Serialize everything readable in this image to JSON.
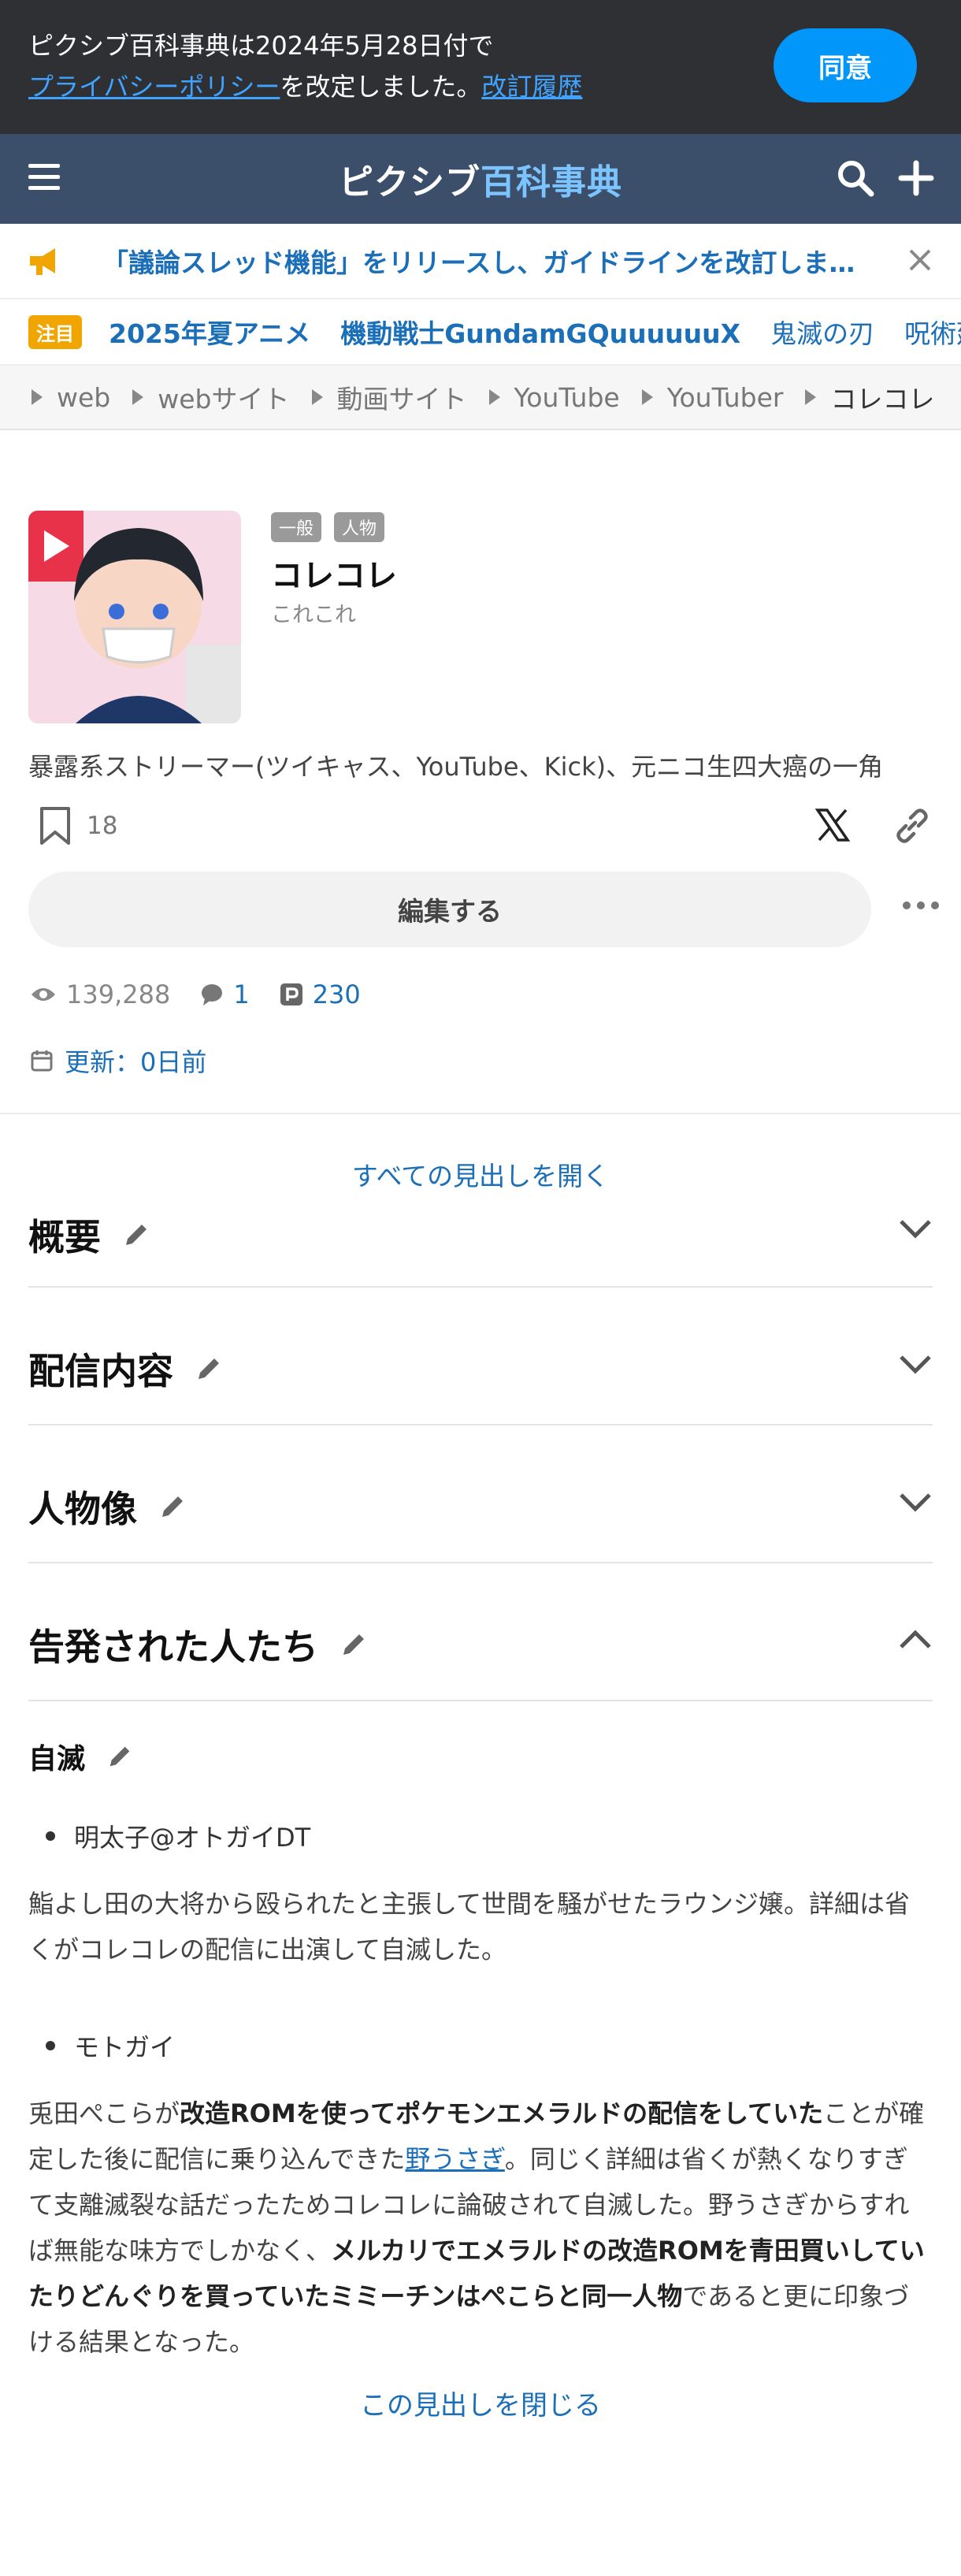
{
  "consent": {
    "line1": "ピクシブ百科事典は2024年5月28日付で",
    "privacy_link": "プライバシーポリシー",
    "line2_mid": "を改定しました。",
    "history_link": "改訂履歴",
    "agree": "同意"
  },
  "header": {
    "logo_a": "ピクシブ",
    "logo_b": "百科事典"
  },
  "announcement": {
    "text": "「議論スレッド機能」をリリースし、ガイドラインを改訂しま…"
  },
  "trending": {
    "badge": "注目",
    "tags": [
      "2025年夏アニメ",
      "機動戦士GundamGQuuuuuuX",
      "鬼滅の刃",
      "呪術廻戦"
    ]
  },
  "breadcrumbs": [
    "web",
    "webサイト",
    "動画サイト",
    "YouTube",
    "YouTuber",
    "コレコレ"
  ],
  "article": {
    "chips": [
      "一般",
      "人物"
    ],
    "title": "コレコレ",
    "reading": "これこれ",
    "description": "暴露系ストリーマー(ツイキャス、YouTube、Kick)、元ニコ生四大癌の一角",
    "bookmarks": "18",
    "edit": "編集する",
    "views": "139,288",
    "comments": "1",
    "pixiv_count": "230",
    "updated": "更新：0日前"
  },
  "toc": {
    "open_all": "すべての見出しを開く",
    "close": "この見出しを閉じる"
  },
  "sections": [
    "概要",
    "配信内容",
    "人物像",
    "告発された人たち"
  ],
  "subsection": {
    "title": "自滅",
    "item1": "明太子@オトガイDT",
    "para1": "鮨よし田の大将から殴られたと主張して世間を騒がせたラウンジ嬢。詳細は省くがコレコレの配信に出演して自滅した。",
    "item2": "モトガイ",
    "p2_a": "兎田ぺこらが",
    "p2_b": "改造ROMを使ってポケモンエメラルドの配信をしていた",
    "p2_c": "ことが確定した後に配信に乗り込んできた",
    "p2_link": "野うさぎ",
    "p2_d": "。同じく詳細は省くが熱くなりすぎて支離滅裂な話だったためコレコレに論破されて自滅した。野うさぎからすれば無能な味方でしかなく、",
    "p2_e": "メルカリでエメラルドの改造ROMを青田買いしていたりどんぐりを買っていたミミーチンはぺこらと同一人物",
    "p2_f": "であると更に印象づける結果となった。"
  },
  "colors": {
    "accent": "#0096fa",
    "link": "#1b6fb8",
    "header_bg": "#3b4f6a",
    "consent_bg": "#2f3034"
  }
}
